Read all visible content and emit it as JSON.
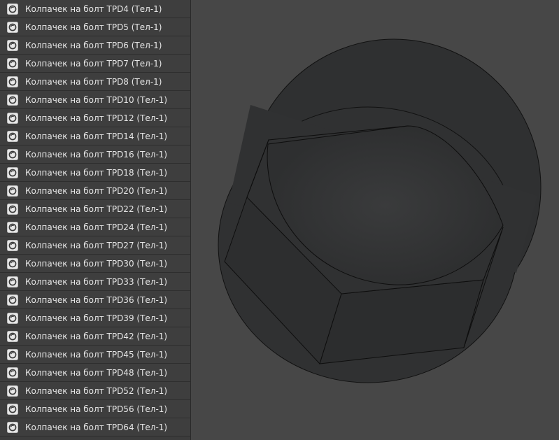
{
  "tree": {
    "items": [
      {
        "label": "Колпачек на болт TPD4 (Тел-1)"
      },
      {
        "label": "Колпачек на болт TPD5 (Тел-1)"
      },
      {
        "label": "Колпачек на болт TPD6 (Тел-1)"
      },
      {
        "label": "Колпачек на болт TPD7 (Тел-1)"
      },
      {
        "label": "Колпачек на болт TPD8 (Тел-1)"
      },
      {
        "label": "Колпачек на болт TPD10 (Тел-1)"
      },
      {
        "label": "Колпачек на болт TPD12 (Тел-1)"
      },
      {
        "label": "Колпачек на болт TPD14 (Тел-1)"
      },
      {
        "label": "Колпачек на болт TPD16 (Тел-1)"
      },
      {
        "label": "Колпачек на болт TPD18 (Тел-1)"
      },
      {
        "label": "Колпачек на болт TPD20 (Тел-1)"
      },
      {
        "label": "Колпачек на болт TPD22 (Тел-1)"
      },
      {
        "label": "Колпачек на болт TPD24 (Тел-1)"
      },
      {
        "label": "Колпачек на болт TPD27 (Тел-1)"
      },
      {
        "label": "Колпачек на болт TPD30 (Тел-1)"
      },
      {
        "label": "Колпачек на болт TPD33 (Тел-1)"
      },
      {
        "label": "Колпачек на болт TPD36 (Тел-1)"
      },
      {
        "label": "Колпачек на болт TPD39 (Тел-1)"
      },
      {
        "label": "Колпачек на болт TPD42 (Тел-1)"
      },
      {
        "label": "Колпачек на болт TPD45 (Тел-1)"
      },
      {
        "label": "Колпачек на болт TPD48 (Тел-1)"
      },
      {
        "label": "Колпачек на болт TPD52 (Тел-1)"
      },
      {
        "label": "Колпачек на болт TPD56 (Тел-1)"
      },
      {
        "label": "Колпачек на болт TPD64 (Тел-1)"
      }
    ],
    "item_icon": "body-part-icon"
  },
  "colors": {
    "panel_bg": "#3e3e3e",
    "row_divider": "#2e2e2e",
    "text": "#e6e6e6",
    "viewport_bg": "#474747",
    "model_fill": "#2f3031",
    "model_edge": "#111111"
  }
}
